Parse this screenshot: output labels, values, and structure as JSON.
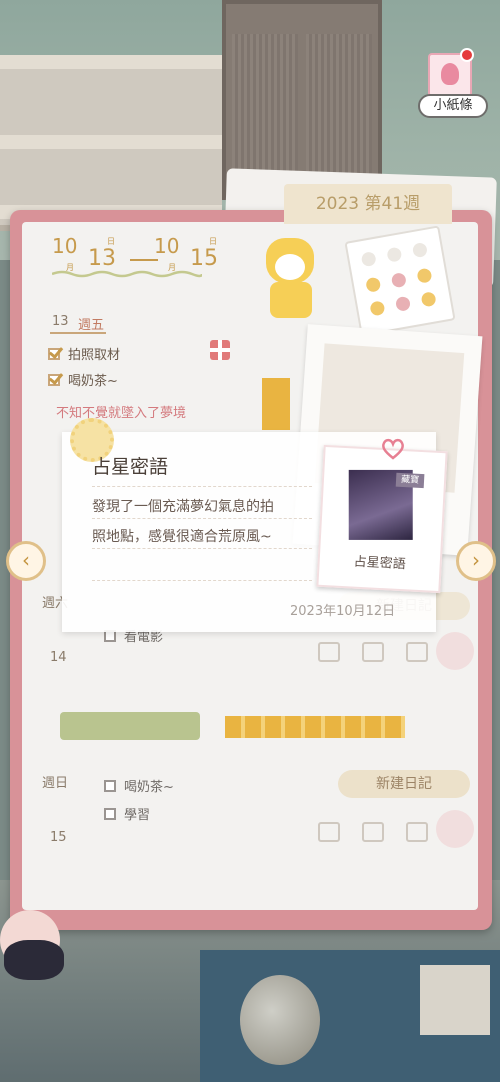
{
  "top_right": {
    "note_label": "小紙條",
    "icon": "avatar-note-icon"
  },
  "diary": {
    "week_tab": "2023 第41週",
    "date_range": {
      "start_month": "10",
      "start_day": "13",
      "end_month": "10",
      "end_day": "15",
      "month_char": "月",
      "day_char": "日"
    },
    "days": [
      {
        "date": "13",
        "weekday": "週五",
        "todos": [
          {
            "text": "拍照取材",
            "checked": true
          },
          {
            "text": "喝奶茶~",
            "checked": true
          }
        ],
        "note": "不知不覺就墜入了夢境"
      },
      {
        "date": "14",
        "weekday": "週六",
        "todos": [
          {
            "text": "看電影",
            "checked": false
          }
        ],
        "new_button": "新建日記"
      },
      {
        "date": "15",
        "weekday": "週日",
        "todos": [
          {
            "text": "喝奶茶~",
            "checked": false
          },
          {
            "text": "學習",
            "checked": false
          }
        ],
        "new_button": "新建日記"
      }
    ]
  },
  "popup": {
    "title": "占星密語",
    "body_line1": "發現了一個充滿夢幻氣息的拍",
    "body_line2": "照地點，感覺很適合荒原風~",
    "date": "2023年10月12日",
    "polaroid_caption": "占星密語",
    "polaroid_tag": "藏寶"
  },
  "nav": {
    "prev_glyph": "‹",
    "next_glyph": "›"
  }
}
